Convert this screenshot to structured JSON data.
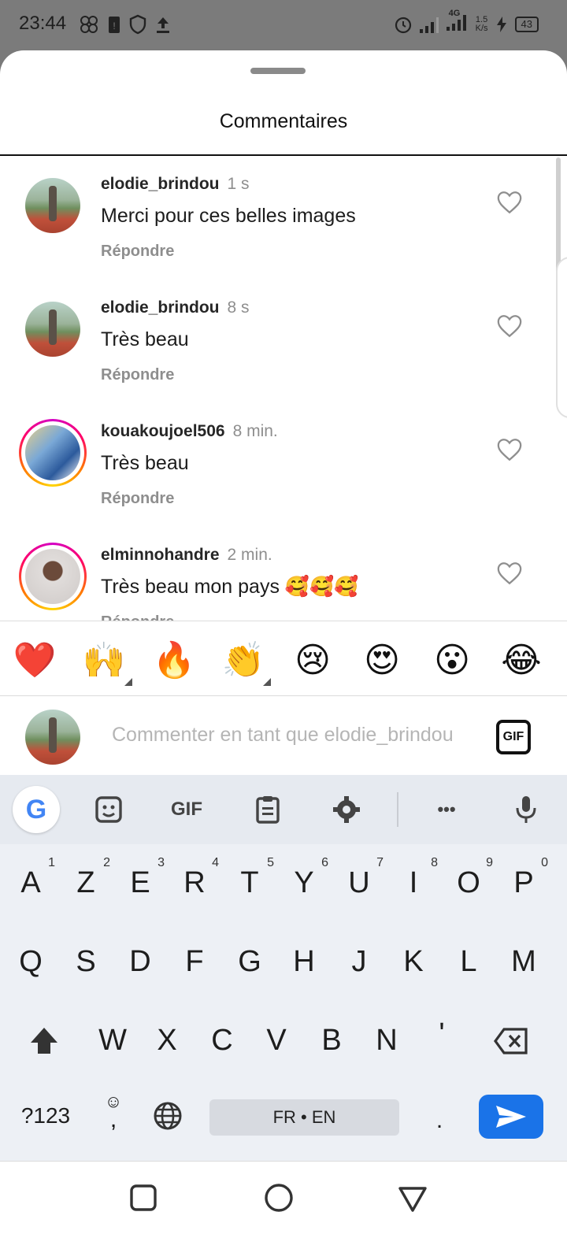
{
  "status_bar": {
    "time": "23:44",
    "network": "4G",
    "speed_value": "1.5",
    "speed_unit": "K/s",
    "battery": "43"
  },
  "sheet": {
    "title": "Commentaires"
  },
  "comments": [
    {
      "username": "elodie_brindou",
      "time": "1 s",
      "text": "Merci pour ces belles images",
      "reply": "Répondre",
      "avatar": "avatar-photo",
      "story_ring": false
    },
    {
      "username": "elodie_brindou",
      "time": "8 s",
      "text": "Très beau",
      "reply": "Répondre",
      "avatar": "avatar-photo",
      "story_ring": false
    },
    {
      "username": "kouakoujoel506",
      "time": "8 min.",
      "text": "Très beau",
      "reply": "Répondre",
      "avatar": "avatar-photo",
      "story_ring": true
    },
    {
      "username": "elminnohandre",
      "time": "2 min.",
      "text": "Très beau mon pays 🥰🥰🥰",
      "reply": "Répondre",
      "avatar": "avatar-photo",
      "story_ring": true
    }
  ],
  "reactions": [
    "❤️",
    "🙌",
    "🔥",
    "👏",
    "😢",
    "😍",
    "😮",
    "😂"
  ],
  "input": {
    "placeholder": "Commenter en tant que elodie_brindou",
    "gif_label": "GIF"
  },
  "keyboard": {
    "toolbar_gif": "GIF",
    "toolbar_more": "•••",
    "row1": [
      {
        "key": "A",
        "hint": "1"
      },
      {
        "key": "Z",
        "hint": "2"
      },
      {
        "key": "E",
        "hint": "3"
      },
      {
        "key": "R",
        "hint": "4"
      },
      {
        "key": "T",
        "hint": "5"
      },
      {
        "key": "Y",
        "hint": "6"
      },
      {
        "key": "U",
        "hint": "7"
      },
      {
        "key": "I",
        "hint": "8"
      },
      {
        "key": "O",
        "hint": "9"
      },
      {
        "key": "P",
        "hint": "0"
      }
    ],
    "row2": [
      "Q",
      "S",
      "D",
      "F",
      "G",
      "H",
      "J",
      "K",
      "L",
      "M"
    ],
    "row3": [
      "W",
      "X",
      "C",
      "V",
      "B",
      "N",
      "'"
    ],
    "symbols_key": "?123",
    "comma_key": ",",
    "space_label": "FR • EN",
    "period_key": "."
  },
  "colors": {
    "accent_blue": "#1a73e8",
    "story_ring": "#ff0069",
    "heart_red": "#e0245e"
  }
}
